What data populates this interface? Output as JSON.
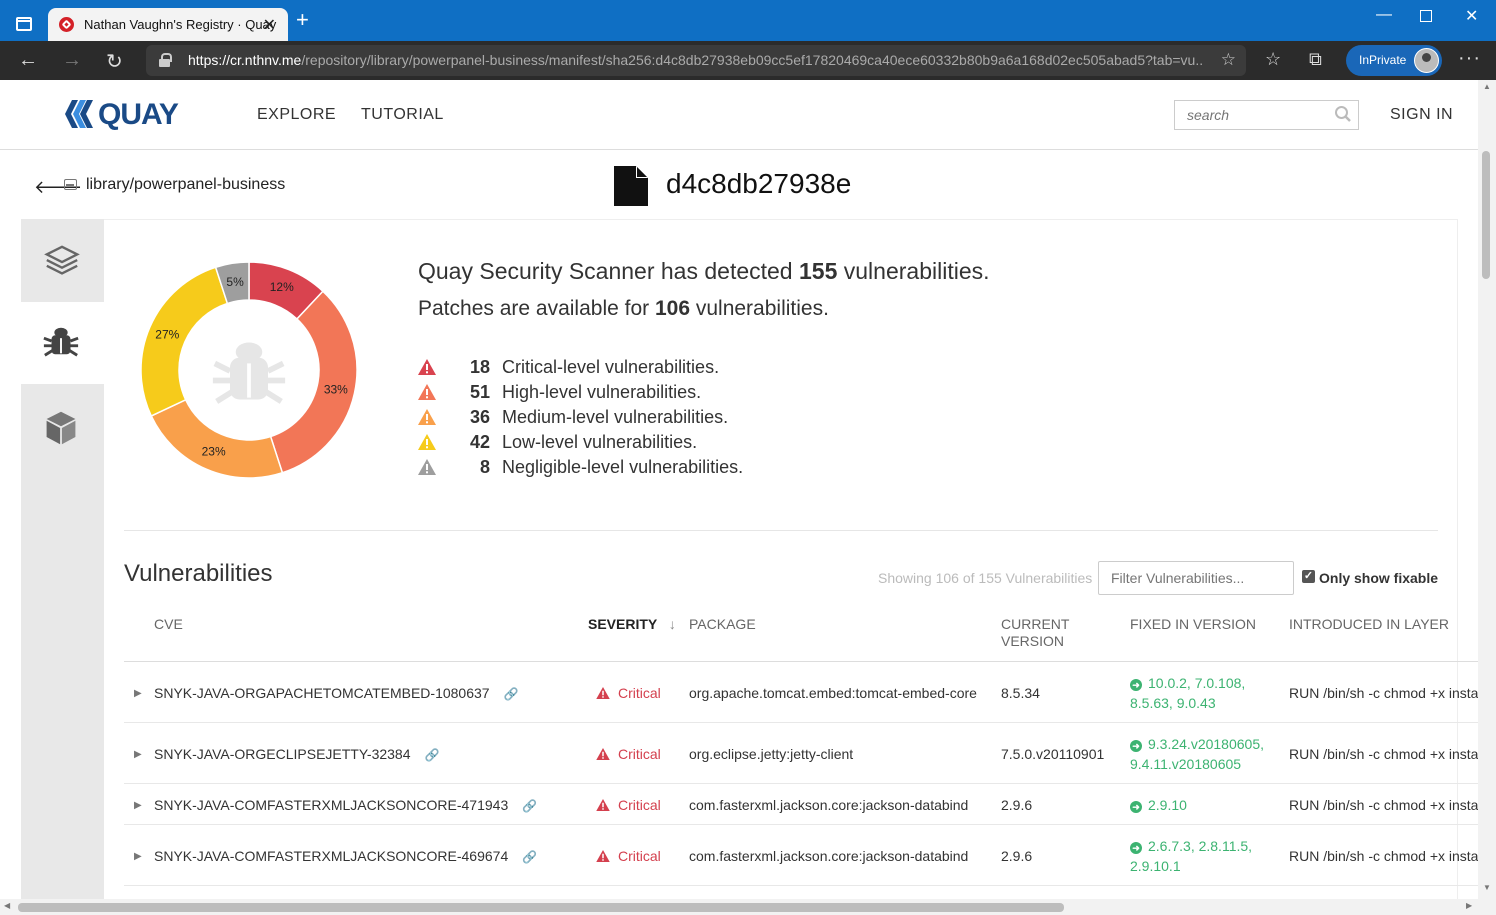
{
  "browser": {
    "tab_title": "Nathan Vaughn's Registry · Quay",
    "url_host": "https://cr.nthnv.me",
    "url_path": "/repository/library/powerpanel-business/manifest/sha256:d4c8db27938eb09cc5ef17820469ca40ece60332b80b9a6a168d02ec505abad5?tab=vu...",
    "inprivate_label": "InPrivate"
  },
  "header": {
    "logo_text": "QUAY",
    "nav": [
      "EXPLORE",
      "TUTORIAL"
    ],
    "search_placeholder": "search",
    "signin_label": "SIGN IN"
  },
  "breadcrumb": {
    "repo": "library/powerpanel-business",
    "digest": "d4c8db27938e"
  },
  "summary": {
    "detected_prefix": "Quay Security Scanner has detected ",
    "detected_count": "155",
    "detected_suffix": " vulnerabilities.",
    "patches_prefix": "Patches are available for ",
    "patches_count": "106",
    "patches_suffix": " vulnerabilities."
  },
  "severity_counts": [
    {
      "count": "18",
      "label": "Critical-level vulnerabilities.",
      "color": "#d9434f"
    },
    {
      "count": "51",
      "label": "High-level vulnerabilities.",
      "color": "#f27657"
    },
    {
      "count": "36",
      "label": "Medium-level vulnerabilities.",
      "color": "#f9a04b"
    },
    {
      "count": "42",
      "label": "Low-level vulnerabilities.",
      "color": "#f6cb1b"
    },
    {
      "count": "8",
      "label": "Negligible-level vulnerabilities.",
      "color": "#9e9e9e"
    }
  ],
  "donut": [
    {
      "pct": "12%",
      "value": 0.12,
      "color": "#d9434f"
    },
    {
      "pct": "33%",
      "value": 0.33,
      "color": "#f27657"
    },
    {
      "pct": "23%",
      "value": 0.23,
      "color": "#f9a04b"
    },
    {
      "pct": "27%",
      "value": 0.27,
      "color": "#f6cb1b"
    },
    {
      "pct": "5%",
      "value": 0.05,
      "color": "#9e9e9e"
    }
  ],
  "vulns": {
    "title": "Vulnerabilities",
    "showing": "Showing 106 of 155 Vulnerabilities",
    "filter_placeholder": "Filter Vulnerabilities...",
    "only_fixable": "Only show fixable",
    "columns": {
      "cve": "CVE",
      "severity": "SEVERITY",
      "package": "PACKAGE",
      "current_1": "CURRENT",
      "current_2": "VERSION",
      "fixed": "FIXED IN VERSION",
      "layer": "INTRODUCED IN LAYER"
    },
    "rows": [
      {
        "cve": "SNYK-JAVA-ORGAPACHETOMCATEMBED-1080637",
        "severity": "Critical",
        "package": "org.apache.tomcat.embed:tomcat-embed-core",
        "current": "8.5.34",
        "fixed1": "10.0.2, 7.0.108,",
        "fixed2": "8.5.63, 9.0.43",
        "layer": "RUN /bin/sh -c chmod +x install"
      },
      {
        "cve": "SNYK-JAVA-ORGECLIPSEJETTY-32384",
        "severity": "Critical",
        "package": "org.eclipse.jetty:jetty-client",
        "current": "7.5.0.v20110901",
        "fixed1": "9.3.24.v20180605,",
        "fixed2": "9.4.11.v20180605",
        "layer": "RUN /bin/sh -c chmod +x install"
      },
      {
        "cve": "SNYK-JAVA-COMFASTERXMLJACKSONCORE-471943",
        "severity": "Critical",
        "package": "com.fasterxml.jackson.core:jackson-databind",
        "current": "2.9.6",
        "fixed1": "2.9.10",
        "fixed2": "",
        "layer": "RUN /bin/sh -c chmod +x install"
      },
      {
        "cve": "SNYK-JAVA-COMFASTERXMLJACKSONCORE-469674",
        "severity": "Critical",
        "package": "com.fasterxml.jackson.core:jackson-databind",
        "current": "2.9.6",
        "fixed1": "2.6.7.3, 2.8.11.5,",
        "fixed2": "2.9.10.1",
        "layer": "RUN /bin/sh -c chmod +x install"
      }
    ]
  }
}
